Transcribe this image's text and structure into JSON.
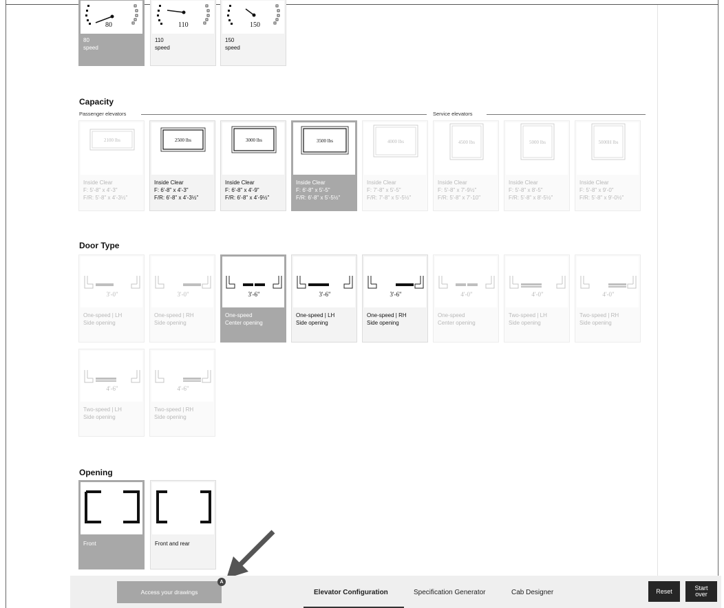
{
  "speed": {
    "cards": [
      {
        "dial": "80",
        "value": "80",
        "unit": "speed"
      },
      {
        "dial": "110",
        "value": "110",
        "unit": "speed"
      },
      {
        "dial": "150",
        "value": "150",
        "unit": "speed"
      }
    ]
  },
  "capacity": {
    "title": "Capacity",
    "passenger_label": "Passenger elevators",
    "service_label": "Service elevators",
    "cards": [
      {
        "badge": "2100 lbs",
        "l1": "Inside Clear",
        "l2": "F: 5'-8\" x 4'-3\"",
        "l3": "F/R: 5'-8\" x 4'-3½\""
      },
      {
        "badge": "2500 lbs",
        "l1": "Inside Clear",
        "l2": "F: 6'-8\" x 4'-3\"",
        "l3": "F/R: 6'-8\" x 4'-3½\""
      },
      {
        "badge": "3000 lbs",
        "l1": "Inside Clear",
        "l2": "F: 6'-8\" x 4'-9\"",
        "l3": "F/R: 6'-8\" x 4'-9½\""
      },
      {
        "badge": "3500 lbs",
        "l1": "Inside Clear",
        "l2": "F: 6'-8\" x 5'-5\"",
        "l3": "F/R: 6'-8\" x 5'-5½\""
      },
      {
        "badge": "4000 lbs",
        "l1": "Inside Clear",
        "l2": "F: 7'-8\" x 5'-5\"",
        "l3": "F/R: 7'-8\" x 5'-5½\""
      },
      {
        "badge": "4500 lbs",
        "l1": "Inside Clear",
        "l2": "F: 5'-8\" x 7'-9½\"",
        "l3": "F/R: 5'-8\" x 7'-10\""
      },
      {
        "badge": "5000 lbs",
        "l1": "Inside Clear",
        "l2": "F: 5'-8\" x 8'-5\"",
        "l3": "F/R: 5'-8\" x 8'-5½\""
      },
      {
        "badge": "5000H lbs",
        "l1": "Inside Clear",
        "l2": "F: 5'-8\" x 9'-0\"",
        "l3": "F/R: 5'-8\" x 9'-0½\""
      }
    ]
  },
  "door_type": {
    "title": "Door Type",
    "cards": [
      {
        "dim": "3'-0\"",
        "l1": "One-speed | LH",
        "l2": "Side opening"
      },
      {
        "dim": "3'-0\"",
        "l1": "One-speed | RH",
        "l2": "Side opening"
      },
      {
        "dim": "3'-6\"",
        "l1": "One-speed",
        "l2": "Center opening"
      },
      {
        "dim": "3'-6\"",
        "l1": "One-speed | LH",
        "l2": "Side opening"
      },
      {
        "dim": "3'-6\"",
        "l1": "One-speed | RH",
        "l2": "Side opening"
      },
      {
        "dim": "4'-0\"",
        "l1": "One-speed",
        "l2": "Center opening"
      },
      {
        "dim": "4'-0\"",
        "l1": "Two-speed | LH",
        "l2": "Side opening"
      },
      {
        "dim": "4'-0\"",
        "l1": "Two-speed | RH",
        "l2": "Side opening"
      },
      {
        "dim": "4'-6\"",
        "l1": "Two-speed | LH",
        "l2": "Side opening"
      },
      {
        "dim": "4'-6\"",
        "l1": "Two-speed | RH",
        "l2": "Side opening"
      }
    ]
  },
  "opening": {
    "title": "Opening",
    "cards": [
      {
        "label": "Front"
      },
      {
        "label": "Front and rear"
      }
    ]
  },
  "footer": {
    "access_label": "Access your drawings",
    "badge": "A",
    "tabs": [
      "Elevator Configuration",
      "Specification Generator",
      "Cab Designer"
    ],
    "reset_label": "Reset",
    "start_over_l1": "Start",
    "start_over_l2": "over"
  },
  "colors": {
    "selected": "#a8a8a8",
    "dark_button": "#262626",
    "footer_bg": "#efefef"
  }
}
